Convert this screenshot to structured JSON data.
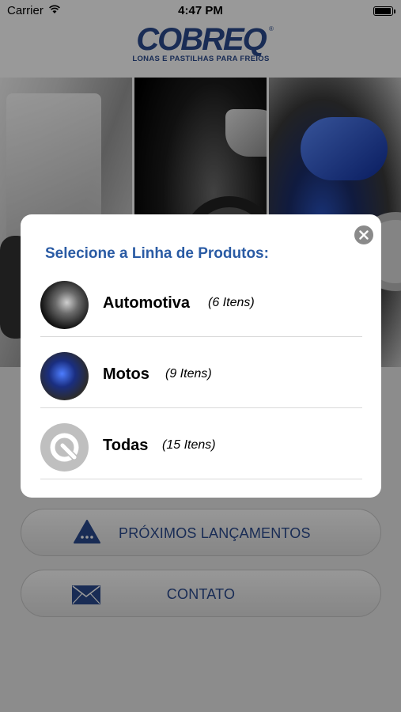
{
  "status_bar": {
    "carrier": "Carrier",
    "time": "4:47 PM"
  },
  "header": {
    "logo_text": "COBREQ",
    "logo_registered": "®",
    "logo_tagline": "LONAS E PASTILHAS PARA FREIOS"
  },
  "hero": {
    "panels": [
      "truck",
      "car",
      "motorcycle"
    ]
  },
  "menu": {
    "launches_label": "PRÓXIMOS LANÇAMENTOS",
    "launches_icon": "warning-triangle-icon",
    "contact_label": "CONTATO",
    "contact_icon": "envelope-icon"
  },
  "modal": {
    "title": "Selecione a Linha de Produtos:",
    "close_icon": "close-circle-icon",
    "items": [
      {
        "name": "Automotiva",
        "count": "(6 Itens)",
        "icon": "car-thumbnail"
      },
      {
        "name": "Motos",
        "count": "(9 Itens)",
        "icon": "motorcycle-thumbnail"
      },
      {
        "name": "Todas",
        "count": "(15 Itens)",
        "icon": "cobreq-q-icon"
      }
    ]
  },
  "colors": {
    "brand_blue": "#2a4a8e",
    "title_blue": "#2a5ba4",
    "overlay": "rgba(0,0,0,0.4)"
  }
}
